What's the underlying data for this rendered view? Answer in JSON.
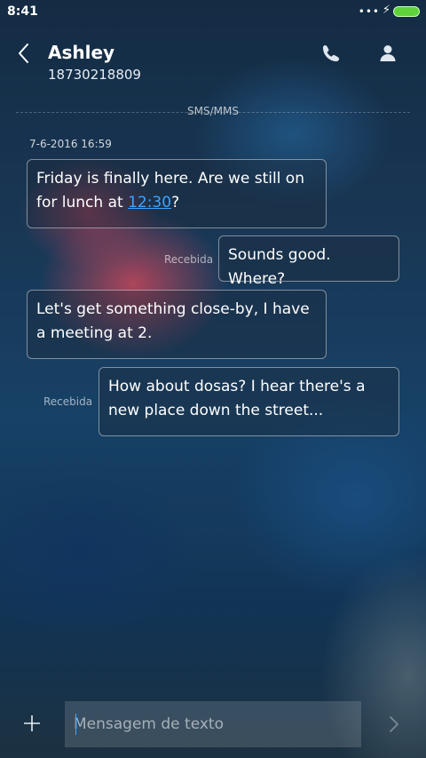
{
  "status_bar": {
    "time": "8:41",
    "dots": "•••",
    "battery_color": "#5fd23a"
  },
  "header": {
    "contact_name": "Ashley",
    "contact_number": "18730218809",
    "icons": [
      "back-arrow-icon",
      "phone-icon",
      "person-icon"
    ]
  },
  "thread": {
    "channel_label": "SMS/MMS",
    "timestamp": "7-6-2016 16:59",
    "messages": [
      {
        "direction": "incoming",
        "text_before": "Friday is finally here. Are we still on for lunch at ",
        "link": "12:30",
        "text_after": "?"
      },
      {
        "direction": "outgoing",
        "text": "Sounds good. Where?",
        "status": "Recebida"
      },
      {
        "direction": "incoming",
        "text": "Let's get something close-by, I have a meeting at 2."
      },
      {
        "direction": "outgoing",
        "text": "How about dosas? I hear there's a new place down the street...",
        "status": "Recebida"
      }
    ]
  },
  "composer": {
    "placeholder": "Mensagem de texto",
    "value": "",
    "icons": [
      "plus-icon",
      "send-arrow-icon"
    ],
    "accent_color": "#3fa4ff"
  }
}
